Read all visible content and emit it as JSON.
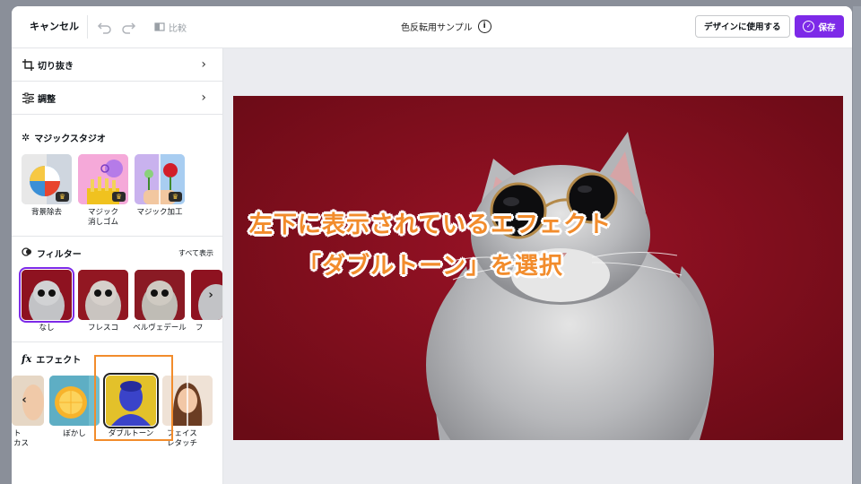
{
  "topbar": {
    "cancel_label": "キャンセル",
    "compare_label": "比較",
    "doc_title": "色反転用サンプル",
    "use_in_design_label": "デザインに使用する",
    "save_label": "保存"
  },
  "sidebar": {
    "crop_label": "切り抜き",
    "adjust_label": "調整",
    "magic_studio": {
      "title": "マジックスタジオ",
      "items": [
        {
          "label": "背景除去",
          "icon": "beach-ball-image"
        },
        {
          "label": "マジック\n消しゴム",
          "icon": "fries-image"
        },
        {
          "label": "マジック加工",
          "icon": "rose-hand-image"
        }
      ]
    },
    "filters": {
      "title": "フィルター",
      "see_all": "すべて表示",
      "items": [
        {
          "label": "なし",
          "selected": true
        },
        {
          "label": "フレスコ"
        },
        {
          "label": "ベルヴェデール"
        },
        {
          "label": "フ"
        }
      ]
    },
    "effects": {
      "title": "エフェクト",
      "items": [
        {
          "label": "ト\nカス"
        },
        {
          "label": "ぼかし"
        },
        {
          "label": "ダブルトーン",
          "selected": true
        },
        {
          "label": "フェイス\nレタッチ"
        }
      ]
    }
  },
  "overlay": {
    "line1": "左下に表示されているエフェクト",
    "line2": "「ダブルトーン」を選択"
  },
  "colors": {
    "accent": "#7d2ae8",
    "annotation": "#f28c2c",
    "photo_background": "#7d0d1a"
  }
}
